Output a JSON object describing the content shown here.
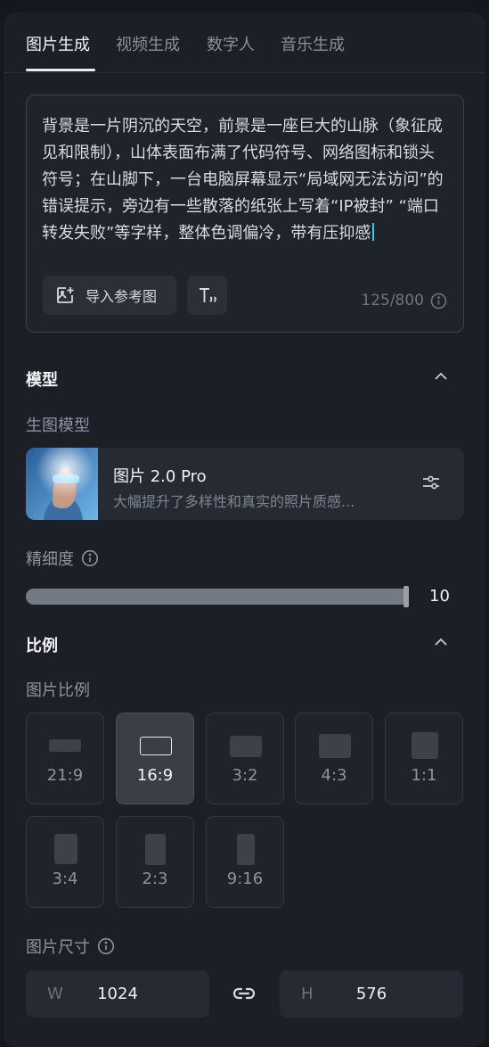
{
  "tabs": [
    {
      "label": "图片生成",
      "active": true
    },
    {
      "label": "视频生成",
      "active": false
    },
    {
      "label": "数字人",
      "active": false
    },
    {
      "label": "音乐生成",
      "active": false
    }
  ],
  "prompt": {
    "text": "背景是一片阴沉的天空，前景是一座巨大的山脉（象征成见和限制），山体表面布满了代码符号、网络图标和锁头符号；在山脚下，一台电脑屏幕显示“局域网无法访问”的错误提示，旁边有一些散落的纸张上写着“IP被封” “端口转发失败”等字样，整体色调偏冷，带有压抑感",
    "import_label": "导入参考图",
    "counter": "125/800",
    "format_icon": "text-format-icon"
  },
  "model_section": {
    "title": "模型",
    "sub_label": "生图模型",
    "model_name": "图片 2.0 Pro",
    "model_desc": "大幅提升了多样性和真实的照片质感..."
  },
  "detail": {
    "label": "精细度",
    "value": 10,
    "max": 10
  },
  "ratio_section": {
    "title": "比例",
    "sub_label": "图片比例",
    "ratios": [
      {
        "label": "21:9",
        "selected": false
      },
      {
        "label": "16:9",
        "selected": true
      },
      {
        "label": "3:2",
        "selected": false
      },
      {
        "label": "4:3",
        "selected": false
      },
      {
        "label": "1:1",
        "selected": false
      },
      {
        "label": "3:4",
        "selected": false
      },
      {
        "label": "2:3",
        "selected": false
      },
      {
        "label": "9:16",
        "selected": false
      }
    ]
  },
  "size_section": {
    "label": "图片尺寸",
    "width_key": "W",
    "width": "1024",
    "height_key": "H",
    "height": "576"
  },
  "colors": {
    "background": "#1c1f26",
    "accent_caret": "#2ad1e6",
    "selected_ratio": "#3a3e47"
  }
}
